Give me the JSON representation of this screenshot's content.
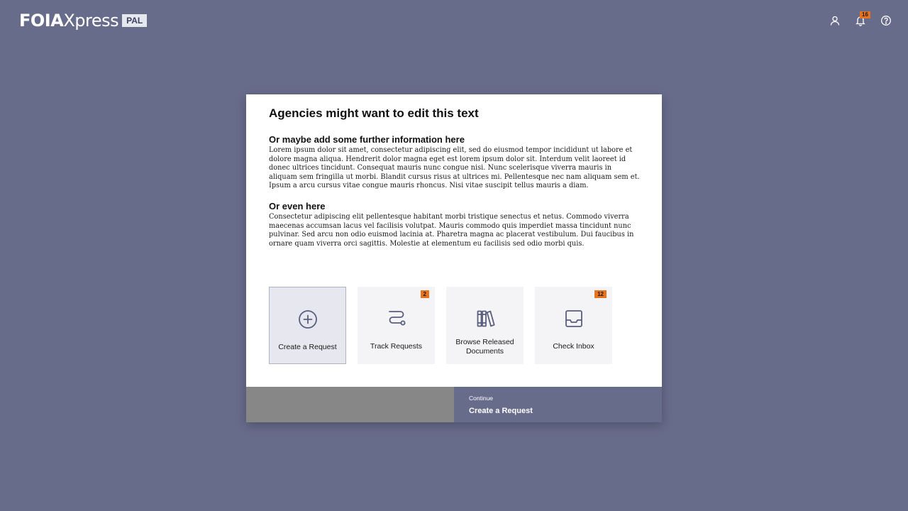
{
  "header": {
    "logo_foia": "FOIA",
    "logo_xpress": "Xpress",
    "logo_pal": "PAL",
    "notification_count": "16",
    "icons": [
      "user-icon",
      "bell-icon",
      "help-icon"
    ]
  },
  "modal": {
    "title": "Agencies might want to edit this text",
    "section1": {
      "heading": "Or maybe add some further information here",
      "text": "Lorem ipsum dolor sit amet, consectetur adipiscing elit, sed do eiusmod tempor incididunt ut labore et dolore magna aliqua. Hendrerit dolor magna eget est lorem ipsum dolor sit. Interdum velit laoreet id donec ultrices tincidunt. Consequat mauris nunc congue nisi. Nunc scelerisque viverra mauris in aliquam sem fringilla ut morbi. Blandit cursus risus at ultrices mi. Pellentesque nec nam aliquam sem et. Ipsum a arcu cursus vitae congue mauris rhoncus. Nisi vitae suscipit tellus mauris a diam."
    },
    "section2": {
      "heading": "Or even here",
      "text": "Consectetur adipiscing elit pellentesque habitant morbi tristique senectus et netus. Commodo viverra maecenas accumsan lacus vel facilisis volutpat. Mauris commodo quis imperdiet massa tincidunt nunc pulvinar. Sed arcu non odio euismod lacinia at. Pharetra magna ac placerat vestibulum. Dui faucibus in ornare quam viverra orci sagittis. Molestie at elementum eu facilisis sed odio morbi quis."
    },
    "tiles": [
      {
        "label": "Create a Request",
        "icon": "plus-circle-icon",
        "badge": "",
        "selected": true
      },
      {
        "label": "Track Requests",
        "icon": "route-icon",
        "badge": "2",
        "selected": false
      },
      {
        "label": "Browse Released Documents",
        "icon": "books-icon",
        "badge": "",
        "selected": false
      },
      {
        "label": "Check Inbox",
        "icon": "inbox-icon",
        "badge": "12",
        "selected": false
      }
    ],
    "footer": {
      "continue_label": "Continue",
      "action_label": "Create a Request"
    }
  },
  "colors": {
    "background": "#686c8b",
    "accent_badge": "#e8731f",
    "footer_left": "#878787",
    "footer_right": "#686c8b",
    "icon_stroke": "#5a5e7e"
  }
}
